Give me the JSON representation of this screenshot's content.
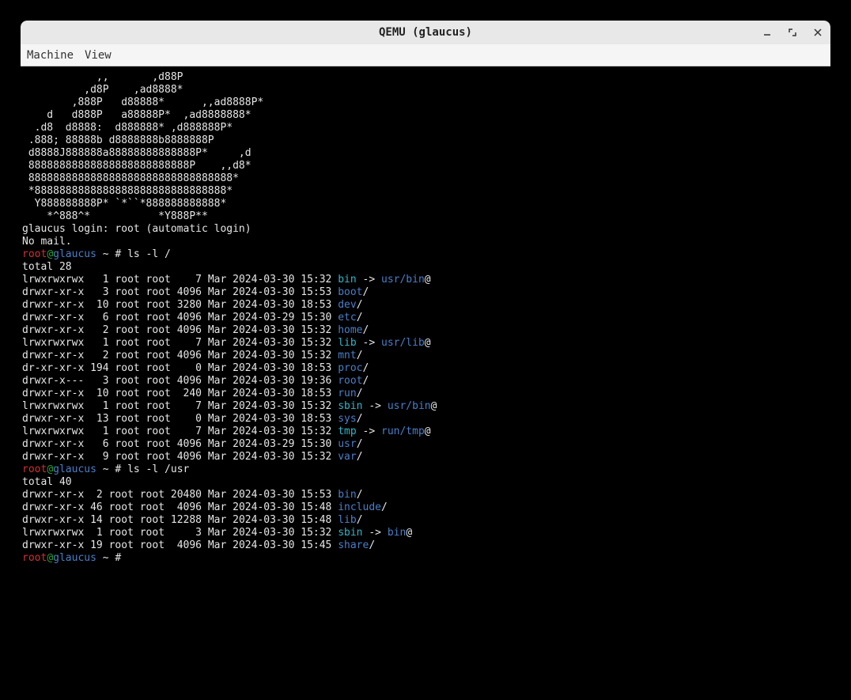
{
  "window": {
    "title": "QEMU (glaucus)",
    "controls": {
      "min": "minimize-icon",
      "max": "maximize-icon",
      "close": "close-icon"
    }
  },
  "menubar": {
    "items": [
      "Machine",
      "View"
    ]
  },
  "ascii_art": [
    "            ,,       ,d88P",
    "          ,d8P    ,ad8888*",
    "        ,888P   d88888*      ,,ad8888P*",
    "    d   d888P   a88888P*  ,ad8888888*",
    "  .d8  d8888:  d888888* ,d888888P*",
    " .888; 88888b d8888888b8888888P",
    " d8888J888888a88888888888888P*     ,d",
    " 88888888888888888888888888P    ,,d8*",
    " 888888888888888888888888888888888*",
    " *8888888888888888888888888888888*",
    "  Y888888888P* `*``*888888888888*",
    "    *^888^*           *Y888P**"
  ],
  "login_line": "glaucus login: root (automatic login)",
  "mail_line": "No mail.",
  "prompts": [
    {
      "user": "root",
      "at": "@",
      "host": "glaucus",
      "rest": " ~ # ",
      "cmd": "ls -l /"
    },
    {
      "user": "root",
      "at": "@",
      "host": "glaucus",
      "rest": " ~ # ",
      "cmd": "ls -l /usr"
    },
    {
      "user": "root",
      "at": "@",
      "host": "glaucus",
      "rest": " ~ # ",
      "cmd": ""
    }
  ],
  "ls_root": {
    "header": "total 28",
    "rows": [
      {
        "perm": "lrwxrwxrwx",
        "n": "   1",
        "own": " root root",
        "size": "    7",
        "date": " Mar 2024-03-30 15:32 ",
        "name": "bin",
        "name_cls": "c-cyan",
        "arrow": " -> ",
        "target": "usr/bin",
        "target_cls": "c-blue",
        "suf": "@"
      },
      {
        "perm": "drwxr-xr-x",
        "n": "   3",
        "own": " root root",
        "size": " 4096",
        "date": " Mar 2024-03-30 15:53 ",
        "name": "boot",
        "name_cls": "c-blue",
        "arrow": "",
        "target": "",
        "target_cls": "",
        "suf": "/"
      },
      {
        "perm": "drwxr-xr-x",
        "n": "  10",
        "own": " root root",
        "size": " 3280",
        "date": " Mar 2024-03-30 18:53 ",
        "name": "dev",
        "name_cls": "c-blue",
        "arrow": "",
        "target": "",
        "target_cls": "",
        "suf": "/"
      },
      {
        "perm": "drwxr-xr-x",
        "n": "   6",
        "own": " root root",
        "size": " 4096",
        "date": " Mar 2024-03-29 15:30 ",
        "name": "etc",
        "name_cls": "c-blue",
        "arrow": "",
        "target": "",
        "target_cls": "",
        "suf": "/"
      },
      {
        "perm": "drwxr-xr-x",
        "n": "   2",
        "own": " root root",
        "size": " 4096",
        "date": " Mar 2024-03-30 15:32 ",
        "name": "home",
        "name_cls": "c-blue",
        "arrow": "",
        "target": "",
        "target_cls": "",
        "suf": "/"
      },
      {
        "perm": "lrwxrwxrwx",
        "n": "   1",
        "own": " root root",
        "size": "    7",
        "date": " Mar 2024-03-30 15:32 ",
        "name": "lib",
        "name_cls": "c-cyan",
        "arrow": " -> ",
        "target": "usr/lib",
        "target_cls": "c-blue",
        "suf": "@"
      },
      {
        "perm": "drwxr-xr-x",
        "n": "   2",
        "own": " root root",
        "size": " 4096",
        "date": " Mar 2024-03-30 15:32 ",
        "name": "mnt",
        "name_cls": "c-blue",
        "arrow": "",
        "target": "",
        "target_cls": "",
        "suf": "/"
      },
      {
        "perm": "dr-xr-xr-x",
        "n": " 194",
        "own": " root root",
        "size": "    0",
        "date": " Mar 2024-03-30 18:53 ",
        "name": "proc",
        "name_cls": "c-blue",
        "arrow": "",
        "target": "",
        "target_cls": "",
        "suf": "/"
      },
      {
        "perm": "drwxr-x---",
        "n": "   3",
        "own": " root root",
        "size": " 4096",
        "date": " Mar 2024-03-30 19:36 ",
        "name": "root",
        "name_cls": "c-blue",
        "arrow": "",
        "target": "",
        "target_cls": "",
        "suf": "/"
      },
      {
        "perm": "drwxr-xr-x",
        "n": "  10",
        "own": " root root",
        "size": "  240",
        "date": " Mar 2024-03-30 18:53 ",
        "name": "run",
        "name_cls": "c-blue",
        "arrow": "",
        "target": "",
        "target_cls": "",
        "suf": "/"
      },
      {
        "perm": "lrwxrwxrwx",
        "n": "   1",
        "own": " root root",
        "size": "    7",
        "date": " Mar 2024-03-30 15:32 ",
        "name": "sbin",
        "name_cls": "c-cyan",
        "arrow": " -> ",
        "target": "usr/bin",
        "target_cls": "c-blue",
        "suf": "@"
      },
      {
        "perm": "drwxr-xr-x",
        "n": "  13",
        "own": " root root",
        "size": "    0",
        "date": " Mar 2024-03-30 18:53 ",
        "name": "sys",
        "name_cls": "c-blue",
        "arrow": "",
        "target": "",
        "target_cls": "",
        "suf": "/"
      },
      {
        "perm": "lrwxrwxrwx",
        "n": "   1",
        "own": " root root",
        "size": "    7",
        "date": " Mar 2024-03-30 15:32 ",
        "name": "tmp",
        "name_cls": "c-cyan",
        "arrow": " -> ",
        "target": "run/tmp",
        "target_cls": "c-blue",
        "suf": "@"
      },
      {
        "perm": "drwxr-xr-x",
        "n": "   6",
        "own": " root root",
        "size": " 4096",
        "date": " Mar 2024-03-29 15:30 ",
        "name": "usr",
        "name_cls": "c-blue",
        "arrow": "",
        "target": "",
        "target_cls": "",
        "suf": "/"
      },
      {
        "perm": "drwxr-xr-x",
        "n": "   9",
        "own": " root root",
        "size": " 4096",
        "date": " Mar 2024-03-30 15:32 ",
        "name": "var",
        "name_cls": "c-blue",
        "arrow": "",
        "target": "",
        "target_cls": "",
        "suf": "/"
      }
    ]
  },
  "ls_usr": {
    "header": "total 40",
    "rows": [
      {
        "perm": "drwxr-xr-x",
        "n": "  2",
        "own": " root root",
        "size": " 20480",
        "date": " Mar 2024-03-30 15:53 ",
        "name": "bin",
        "name_cls": "c-blue",
        "arrow": "",
        "target": "",
        "target_cls": "",
        "suf": "/"
      },
      {
        "perm": "drwxr-xr-x",
        "n": " 46",
        "own": " root root",
        "size": "  4096",
        "date": " Mar 2024-03-30 15:48 ",
        "name": "include",
        "name_cls": "c-blue",
        "arrow": "",
        "target": "",
        "target_cls": "",
        "suf": "/"
      },
      {
        "perm": "drwxr-xr-x",
        "n": " 14",
        "own": " root root",
        "size": " 12288",
        "date": " Mar 2024-03-30 15:48 ",
        "name": "lib",
        "name_cls": "c-blue",
        "arrow": "",
        "target": "",
        "target_cls": "",
        "suf": "/"
      },
      {
        "perm": "lrwxrwxrwx",
        "n": "  1",
        "own": " root root",
        "size": "     3",
        "date": " Mar 2024-03-30 15:32 ",
        "name": "sbin",
        "name_cls": "c-cyan",
        "arrow": " -> ",
        "target": "bin",
        "target_cls": "c-blue",
        "suf": "@"
      },
      {
        "perm": "drwxr-xr-x",
        "n": " 19",
        "own": " root root",
        "size": "  4096",
        "date": " Mar 2024-03-30 15:45 ",
        "name": "share",
        "name_cls": "c-blue",
        "arrow": "",
        "target": "",
        "target_cls": "",
        "suf": "/"
      }
    ]
  }
}
